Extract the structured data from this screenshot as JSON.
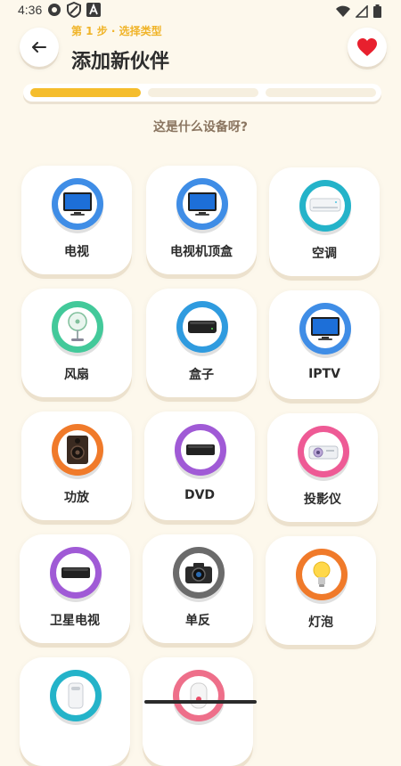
{
  "status_bar": {
    "time": "4:36"
  },
  "header": {
    "step_label": "第 1 步 · 选择类型",
    "title": "添加新伙伴",
    "back_icon": "arrow-left-icon",
    "favorite_icon": "heart-icon"
  },
  "progress": {
    "total_steps": 3,
    "current_step": 1,
    "active_color": "#f5bd2c"
  },
  "question": "这是什么设备呀?",
  "devices": [
    {
      "label": "电视",
      "icon": "tv-icon",
      "color": "#3f8de6"
    },
    {
      "label": "电视机顶盒",
      "icon": "tv-icon",
      "color": "#3f8de6"
    },
    {
      "label": "空调",
      "icon": "air-conditioner-icon",
      "color": "#24b3c9"
    },
    {
      "label": "风扇",
      "icon": "fan-icon",
      "color": "#43c99a"
    },
    {
      "label": "盒子",
      "icon": "media-box-icon",
      "color": "#2f9bdf"
    },
    {
      "label": "IPTV",
      "icon": "tv-icon",
      "color": "#3f8de6"
    },
    {
      "label": "功放",
      "icon": "speaker-icon",
      "color": "#f07a2a"
    },
    {
      "label": "DVD",
      "icon": "dvd-player-icon",
      "color": "#a05ad6"
    },
    {
      "label": "投影仪",
      "icon": "projector-icon",
      "color": "#ee5a95"
    },
    {
      "label": "卫星电视",
      "icon": "satellite-box-icon",
      "color": "#a05ad6"
    },
    {
      "label": "单反",
      "icon": "camera-icon",
      "color": "#6b6b6b"
    },
    {
      "label": "灯泡",
      "icon": "lightbulb-icon",
      "color": "#f07a2a"
    },
    {
      "label": "",
      "icon": "air-purifier-icon",
      "color": "#24b3c9"
    },
    {
      "label": "",
      "icon": "water-heater-icon",
      "color": "#ee6f8a"
    }
  ]
}
